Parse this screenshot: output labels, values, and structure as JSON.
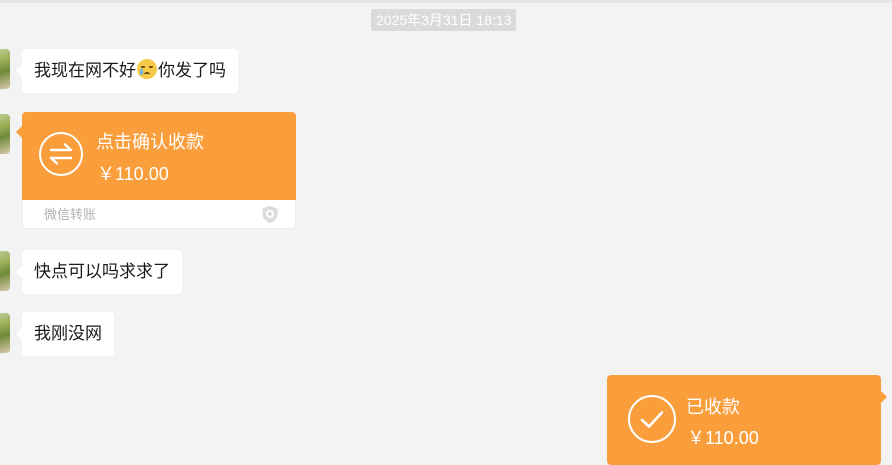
{
  "chat": {
    "timestamp": "2025年3月31日 18:13",
    "messages": [
      {
        "sender": "other",
        "text_before": "我现在网不好",
        "emoji": "crying-face-emoji",
        "text_after": "你发了吗"
      },
      {
        "sender": "other",
        "text": "快点可以吗求求了"
      },
      {
        "sender": "other",
        "text": "我刚没网"
      }
    ],
    "transfer_request": {
      "title": "点击确认收款",
      "amount": "￥110.00",
      "footer": "微信转账",
      "icon": "transfer-arrows-icon"
    },
    "transfer_received": {
      "title": "已收款",
      "amount": "￥110.00",
      "icon": "check-icon"
    }
  },
  "colors": {
    "background": "#f3f3f3",
    "transfer_orange": "#fa9d3b",
    "bubble": "#ffffff",
    "timestamp_bg": "#dadada"
  }
}
